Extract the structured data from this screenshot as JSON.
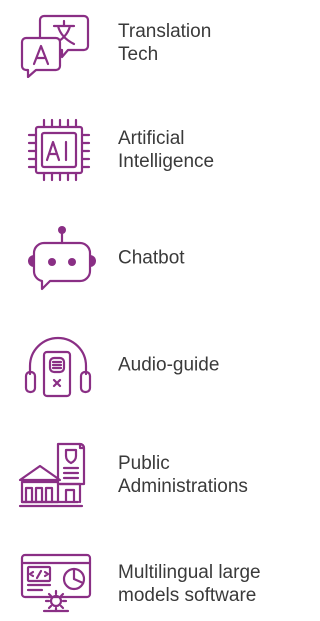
{
  "colors": {
    "accent": "#8a2f85",
    "text": "#3a3a3a",
    "background": "#ffffff"
  },
  "items": [
    {
      "icon": "translation-chat-icon",
      "label": "Translation\nTech"
    },
    {
      "icon": "ai-chip-icon",
      "label": "Artificial\nIntelligence"
    },
    {
      "icon": "chatbot-icon",
      "label": "Chatbot"
    },
    {
      "icon": "audio-guide-headphones-icon",
      "label": "Audio-guide"
    },
    {
      "icon": "public-building-document-icon",
      "label": "Public\nAdministrations"
    },
    {
      "icon": "multilingual-software-icon",
      "label": "Multilingual large\nmodels software"
    }
  ]
}
